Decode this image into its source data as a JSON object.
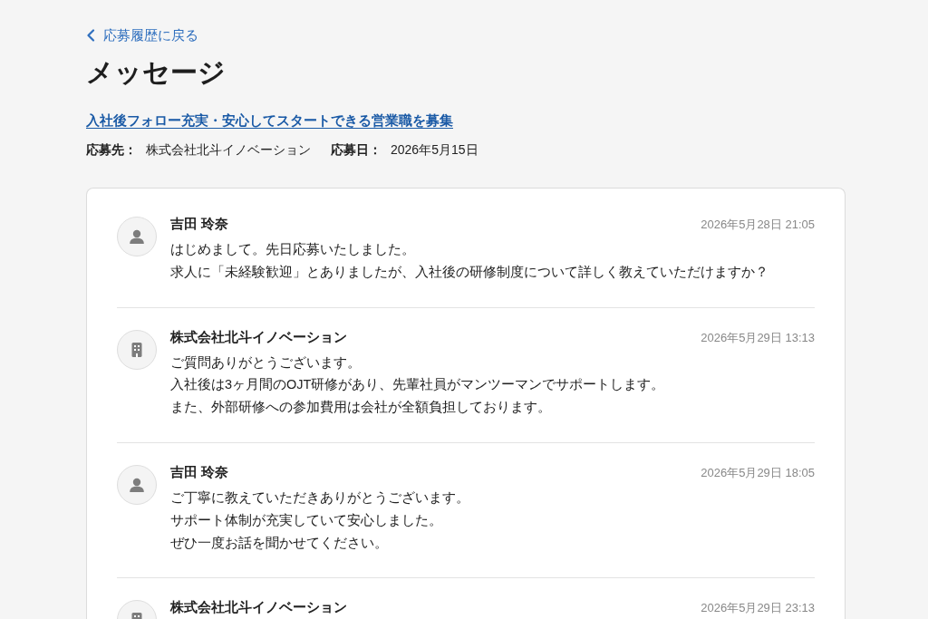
{
  "back_link": {
    "label": "応募履歴に戻る"
  },
  "page_title": "メッセージ",
  "job_link": "入社後フォロー充実・安心してスタートできる営業職を募集",
  "application_info": [
    {
      "label": "応募先：",
      "value": "株式会社北斗イノベーション"
    },
    {
      "label": "応募日：",
      "value": "2026年5月15日"
    }
  ],
  "messages": [
    {
      "kind": "applicant",
      "sender": "吉田 玲奈",
      "timestamp": "2026年5月28日 21:05",
      "lines": [
        "はじめまして。先日応募いたしました。",
        "求人に「未経験歓迎」とありましたが、入社後の研修制度について詳しく教えていただけますか？"
      ]
    },
    {
      "kind": "company",
      "sender": "株式会社北斗イノベーション",
      "timestamp": "2026年5月29日 13:13",
      "lines": [
        "ご質問ありがとうございます。",
        "入社後は3ヶ月間のOJT研修があり、先輩社員がマンツーマンでサポートします。",
        "また、外部研修への参加費用は会社が全額負担しております。"
      ]
    },
    {
      "kind": "applicant",
      "sender": "吉田 玲奈",
      "timestamp": "2026年5月29日 18:05",
      "lines": [
        "ご丁寧に教えていただきありがとうございます。",
        "サポート体制が充実していて安心しました。",
        "ぜひ一度お話を聞かせてください。"
      ]
    },
    {
      "kind": "company",
      "sender": "株式会社北斗イノベーション",
      "timestamp": "2026年5月29日 23:13"
    }
  ]
}
